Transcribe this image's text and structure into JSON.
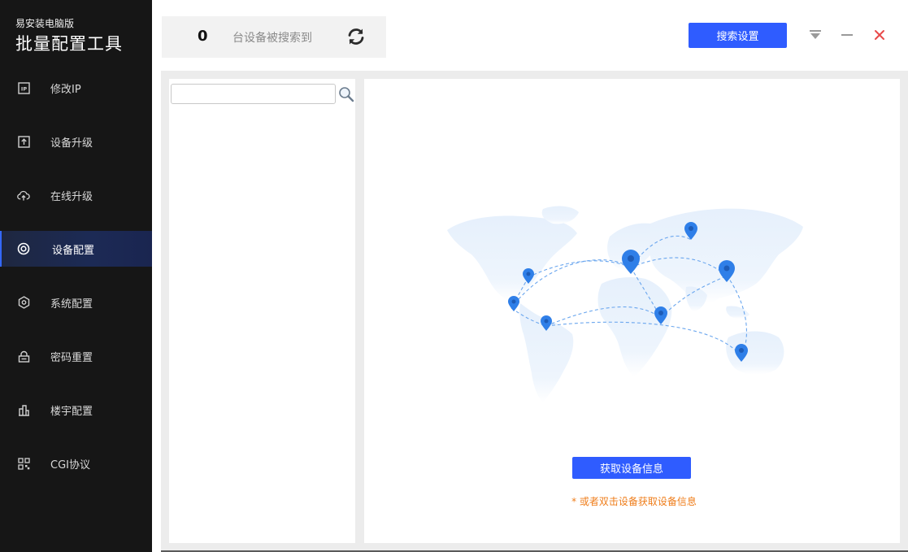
{
  "brand": {
    "subtitle": "易安装电脑版",
    "title": "批量配置工具"
  },
  "sidebar": {
    "items": [
      {
        "label": "修改IP",
        "icon": "ip-icon",
        "active": false
      },
      {
        "label": "设备升级",
        "icon": "upload-box-icon",
        "active": false
      },
      {
        "label": "在线升级",
        "icon": "cloud-upload-icon",
        "active": false
      },
      {
        "label": "设备配置",
        "icon": "target-icon",
        "active": true
      },
      {
        "label": "系统配置",
        "icon": "hexagon-gear-icon",
        "active": false
      },
      {
        "label": "密码重置",
        "icon": "lock-icon",
        "active": false
      },
      {
        "label": "楼宇配置",
        "icon": "building-icon",
        "active": false
      },
      {
        "label": "CGI协议",
        "icon": "qr-grid-icon",
        "active": false
      }
    ]
  },
  "header": {
    "device_count": "0",
    "device_count_label": "台设备被搜索到",
    "search_settings_label": "搜索设置"
  },
  "search": {
    "value": "",
    "placeholder": ""
  },
  "main": {
    "fetch_button_label": "获取设备信息",
    "hint": "* 或者双击设备获取设备信息"
  },
  "colors": {
    "accent": "#2f5cff",
    "sidebar_bg": "#161616",
    "active_bg": "#1c2a55",
    "hint": "#ef7d1a",
    "close": "#e84a4a",
    "map_pin": "#2f7fe8",
    "map_land": "#e9f2fd"
  }
}
